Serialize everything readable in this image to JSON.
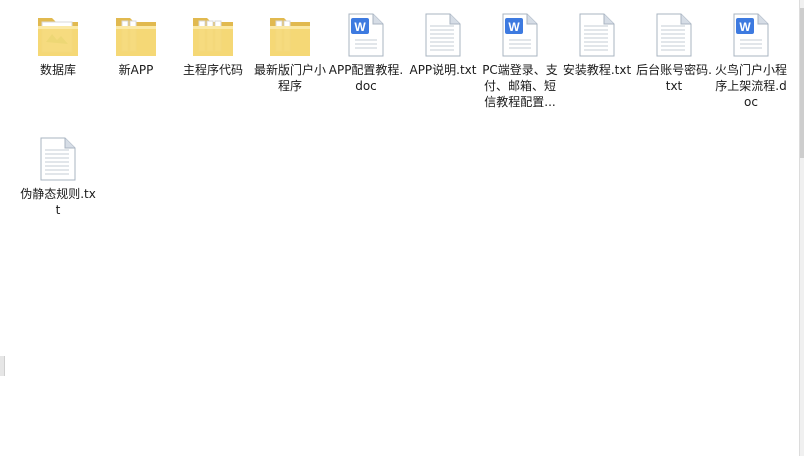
{
  "colors": {
    "folder_back": "#e7c35c",
    "folder_front": "#f5d978",
    "folder_paper": "#ffffff",
    "doc_border": "#a9b4c2",
    "doc_fold": "#d6dde6",
    "doc_lines": "#c5ccd6",
    "wps_blue": "#3d7ae0"
  },
  "files": [
    {
      "label": "数据库",
      "icon": "folder-icon"
    },
    {
      "label": "新APP",
      "icon": "folder-icon"
    },
    {
      "label": "主程序代码",
      "icon": "folder-icon"
    },
    {
      "label": "最新版门户小程序",
      "icon": "folder-icon"
    },
    {
      "label": "APP配置教程.doc",
      "icon": "word-doc-icon"
    },
    {
      "label": "APP说明.txt",
      "icon": "text-file-icon"
    },
    {
      "label": "PC端登录、支付、邮箱、短信教程配置...",
      "icon": "word-doc-icon"
    },
    {
      "label": "安装教程.txt",
      "icon": "text-file-icon"
    },
    {
      "label": "后台账号密码.txt",
      "icon": "text-file-icon"
    },
    {
      "label": "火鸟门户小程序上架流程.doc",
      "icon": "word-doc-icon"
    },
    {
      "label": "伪静态规则.txt",
      "icon": "text-file-icon"
    }
  ]
}
